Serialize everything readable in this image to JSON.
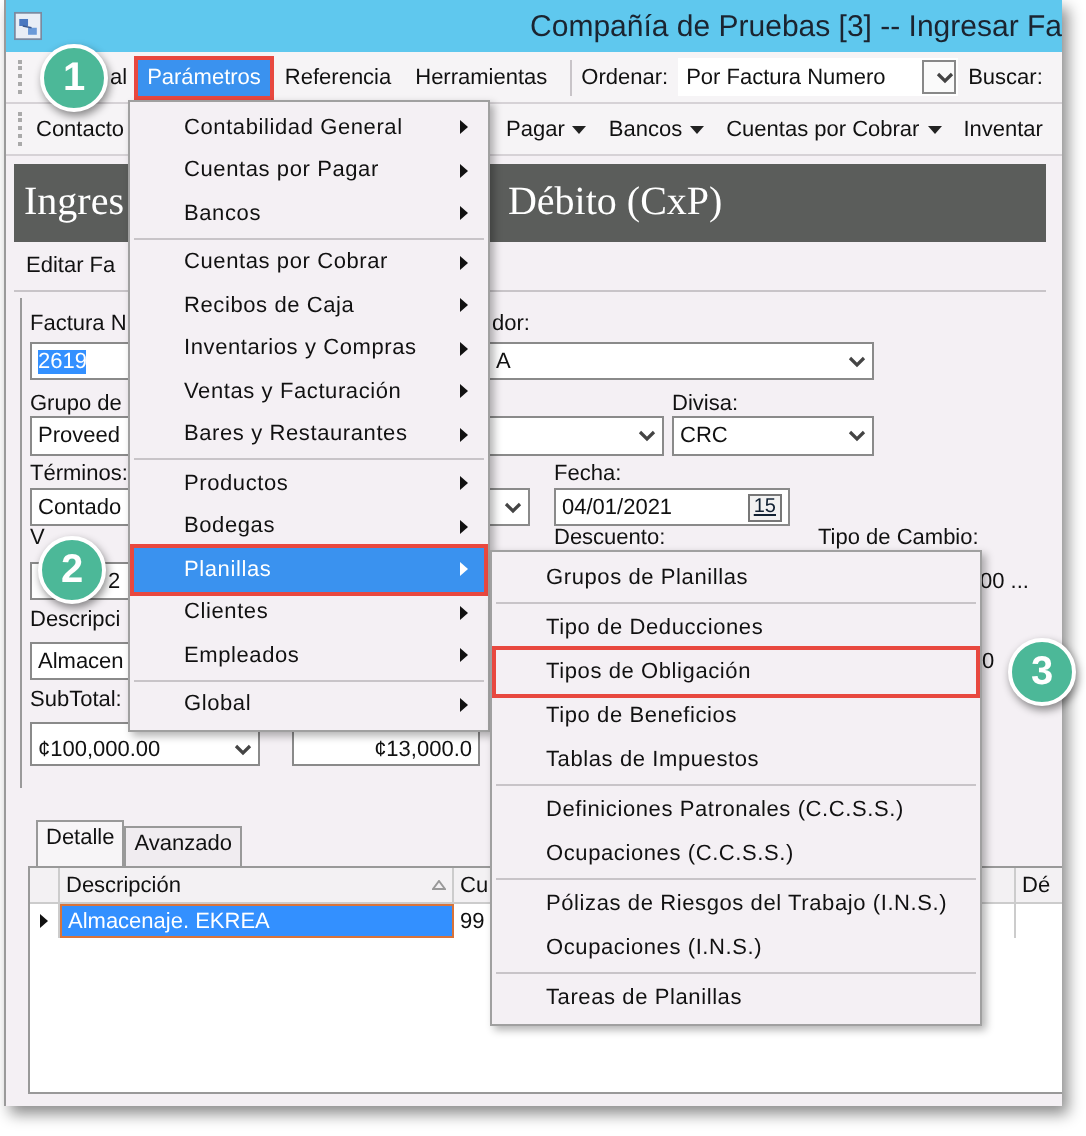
{
  "window": {
    "title": "Compañía de Pruebas [3] -- Ingresar Fa"
  },
  "menu_bar": {
    "items": [
      {
        "label": "al",
        "selected": false,
        "outlined": false
      },
      {
        "label": "Parámetros",
        "selected": true,
        "outlined": true,
        "callout": {
          "number": "1"
        }
      },
      {
        "label": "Referencia",
        "selected": false,
        "outlined": false
      },
      {
        "label": "Herramientas",
        "selected": false,
        "outlined": false
      }
    ],
    "sort_label": "Ordenar:",
    "sort_value": "Por Factura Numero",
    "search_label": "Buscar:"
  },
  "toolbar": {
    "items": [
      {
        "label": "Contacto",
        "dropdown": false
      },
      {
        "label": "Pagar",
        "dropdown": true
      },
      {
        "label": "Bancos",
        "dropdown": true
      },
      {
        "label": "Cuentas por Cobrar",
        "dropdown": true
      },
      {
        "label": "Inventar",
        "dropdown": false
      }
    ]
  },
  "header": {
    "title_start": "Ingres",
    "title_end": "Débito (CxP)"
  },
  "edit_strip": {
    "label": "Editar Fa"
  },
  "form_rows": [
    [
      {
        "kind": "label",
        "text": "Factura N"
      },
      {
        "kind": "label",
        "text": "dor:"
      }
    ],
    [
      {
        "kind": "text",
        "value": "2619",
        "text_selected": true
      },
      {
        "kind": "combo",
        "value": "A"
      }
    ],
    [
      {
        "kind": "label",
        "text": "Grupo de"
      },
      {
        "kind": "label",
        "text": "Divisa:"
      }
    ],
    [
      {
        "kind": "text",
        "value": "Proveed",
        "text_selected": false
      },
      {
        "kind": "combo"
      },
      {
        "kind": "combo",
        "value": "CRC"
      }
    ],
    [
      {
        "kind": "label",
        "text": "Términos:"
      },
      {
        "kind": "label",
        "text": "Fecha:"
      }
    ],
    [
      {
        "kind": "combo",
        "value": "Contado"
      },
      {
        "kind": "date",
        "value": "04/01/2021",
        "calendar": "15"
      }
    ],
    [
      {
        "kind": "label",
        "text": "V"
      },
      {
        "kind": "label",
        "text": "Descuento:"
      },
      {
        "kind": "label",
        "text": "Tipo de Cambio:"
      }
    ],
    [
      {
        "kind": "text",
        "value": "2",
        "text_selected": false
      },
      {
        "kind": "value",
        "text": "00 ..."
      }
    ],
    [
      {
        "kind": "label",
        "text": "Descripci"
      }
    ],
    [
      {
        "kind": "text",
        "value": "Almacen",
        "text_selected": false
      },
      {
        "kind": "value",
        "text": "0"
      }
    ],
    [
      {
        "kind": "label",
        "text": "SubTotal:"
      }
    ],
    [
      {
        "kind": "amount",
        "value": "¢100,000.00",
        "dropdown": true
      },
      {
        "kind": "amount",
        "value": "¢13,000.0",
        "dropdown": false
      }
    ]
  ],
  "tabs": [
    {
      "label": "Detalle",
      "selected": true
    },
    {
      "label": "Avanzado",
      "selected": false
    }
  ],
  "table": {
    "columns": [
      {
        "label": "Descripción",
        "sorted": true
      },
      {
        "label": "Cu",
        "sorted": false
      },
      {
        "label": "Dé",
        "sorted": false
      }
    ],
    "rows": [
      {
        "current": true,
        "selected": true,
        "cells": [
          "Almacenaje. EKREA",
          "99"
        ]
      }
    ]
  },
  "menu": {
    "items": [
      {
        "kind": "item",
        "label": "Contabilidad General",
        "submenu": true,
        "selected": false,
        "outlined": false
      },
      {
        "kind": "item",
        "label": "Cuentas por Pagar",
        "submenu": true,
        "selected": false,
        "outlined": false
      },
      {
        "kind": "item",
        "label": "Bancos",
        "submenu": true,
        "selected": false,
        "outlined": false
      },
      {
        "kind": "separator"
      },
      {
        "kind": "item",
        "label": "Cuentas por Cobrar",
        "submenu": true,
        "selected": false,
        "outlined": false
      },
      {
        "kind": "item",
        "label": "Recibos de Caja",
        "submenu": true,
        "selected": false,
        "outlined": false
      },
      {
        "kind": "item",
        "label": "Inventarios y Compras",
        "submenu": true,
        "selected": false,
        "outlined": false
      },
      {
        "kind": "item",
        "label": "Ventas y Facturación",
        "submenu": true,
        "selected": false,
        "outlined": false
      },
      {
        "kind": "item",
        "label": "Bares y Restaurantes",
        "submenu": true,
        "selected": false,
        "outlined": false
      },
      {
        "kind": "separator"
      },
      {
        "kind": "item",
        "label": "Productos",
        "submenu": true,
        "selected": false,
        "outlined": false
      },
      {
        "kind": "item",
        "label": "Bodegas",
        "submenu": true,
        "selected": false,
        "outlined": false
      },
      {
        "kind": "item",
        "label": "Planillas",
        "submenu": true,
        "selected": true,
        "outlined": true,
        "callout": {
          "number": "2"
        }
      },
      {
        "kind": "item",
        "label": "Clientes",
        "submenu": true,
        "selected": false,
        "outlined": false
      },
      {
        "kind": "item",
        "label": "Empleados",
        "submenu": true,
        "selected": false,
        "outlined": false
      },
      {
        "kind": "separator"
      },
      {
        "kind": "item",
        "label": "Global",
        "submenu": true,
        "selected": false,
        "outlined": false
      }
    ]
  },
  "submenu": {
    "items": [
      {
        "kind": "item",
        "label": "Grupos de Planillas",
        "submenu": false,
        "selected": false,
        "outlined": false
      },
      {
        "kind": "separator"
      },
      {
        "kind": "item",
        "label": "Tipo de Deducciones",
        "submenu": false,
        "selected": false,
        "outlined": false
      },
      {
        "kind": "item",
        "label": "Tipos de Obligación",
        "submenu": false,
        "selected": false,
        "outlined": true,
        "callout": {
          "number": "3"
        }
      },
      {
        "kind": "item",
        "label": "Tipo de Beneficios",
        "submenu": false,
        "selected": false,
        "outlined": false
      },
      {
        "kind": "item",
        "label": "Tablas de Impuestos",
        "submenu": false,
        "selected": false,
        "outlined": false
      },
      {
        "kind": "separator"
      },
      {
        "kind": "item",
        "label": "Definiciones Patronales (C.C.S.S.)",
        "submenu": false,
        "selected": false,
        "outlined": false
      },
      {
        "kind": "item",
        "label": "Ocupaciones (C.C.S.S.)",
        "submenu": false,
        "selected": false,
        "outlined": false
      },
      {
        "kind": "separator"
      },
      {
        "kind": "item",
        "label": "Pólizas de Riesgos del Trabajo (I.N.S.)",
        "submenu": false,
        "selected": false,
        "outlined": false
      },
      {
        "kind": "item",
        "label": "Ocupaciones (I.N.S.)",
        "submenu": false,
        "selected": false,
        "outlined": false
      },
      {
        "kind": "separator"
      },
      {
        "kind": "item",
        "label": "Tareas de Planillas",
        "submenu": false,
        "selected": false,
        "outlined": false
      }
    ]
  }
}
